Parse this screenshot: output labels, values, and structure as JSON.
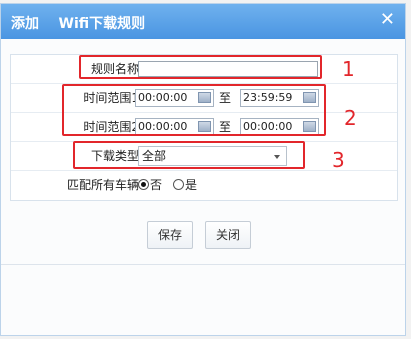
{
  "dialog": {
    "title": "添加    Wifi下载规则",
    "close_glyph": "✕"
  },
  "form": {
    "rule_name": {
      "label": "规则名称",
      "value": ""
    },
    "time_range_1": {
      "label": "时间范围1",
      "start": "00:00:00",
      "to": "至",
      "end": "23:59:59"
    },
    "time_range_2": {
      "label": "时间范围2",
      "start": "00:00:00",
      "to": "至",
      "end": "00:00:00"
    },
    "download_type": {
      "label": "下载类型",
      "selected": "全部"
    },
    "match_all_vehicles": {
      "label": "匹配所有车辆",
      "options": [
        {
          "label": "否",
          "selected": true
        },
        {
          "label": "是",
          "selected": false
        }
      ]
    }
  },
  "buttons": {
    "save_label": "保存",
    "close_label": "关闭"
  },
  "annotations": [
    "1",
    "2",
    "3"
  ],
  "colors": {
    "titlebar": "#4a95e2",
    "annotation": "#e2262b"
  },
  "icons": [
    "close-icon",
    "calendar-icon",
    "chevron-down-icon"
  ]
}
